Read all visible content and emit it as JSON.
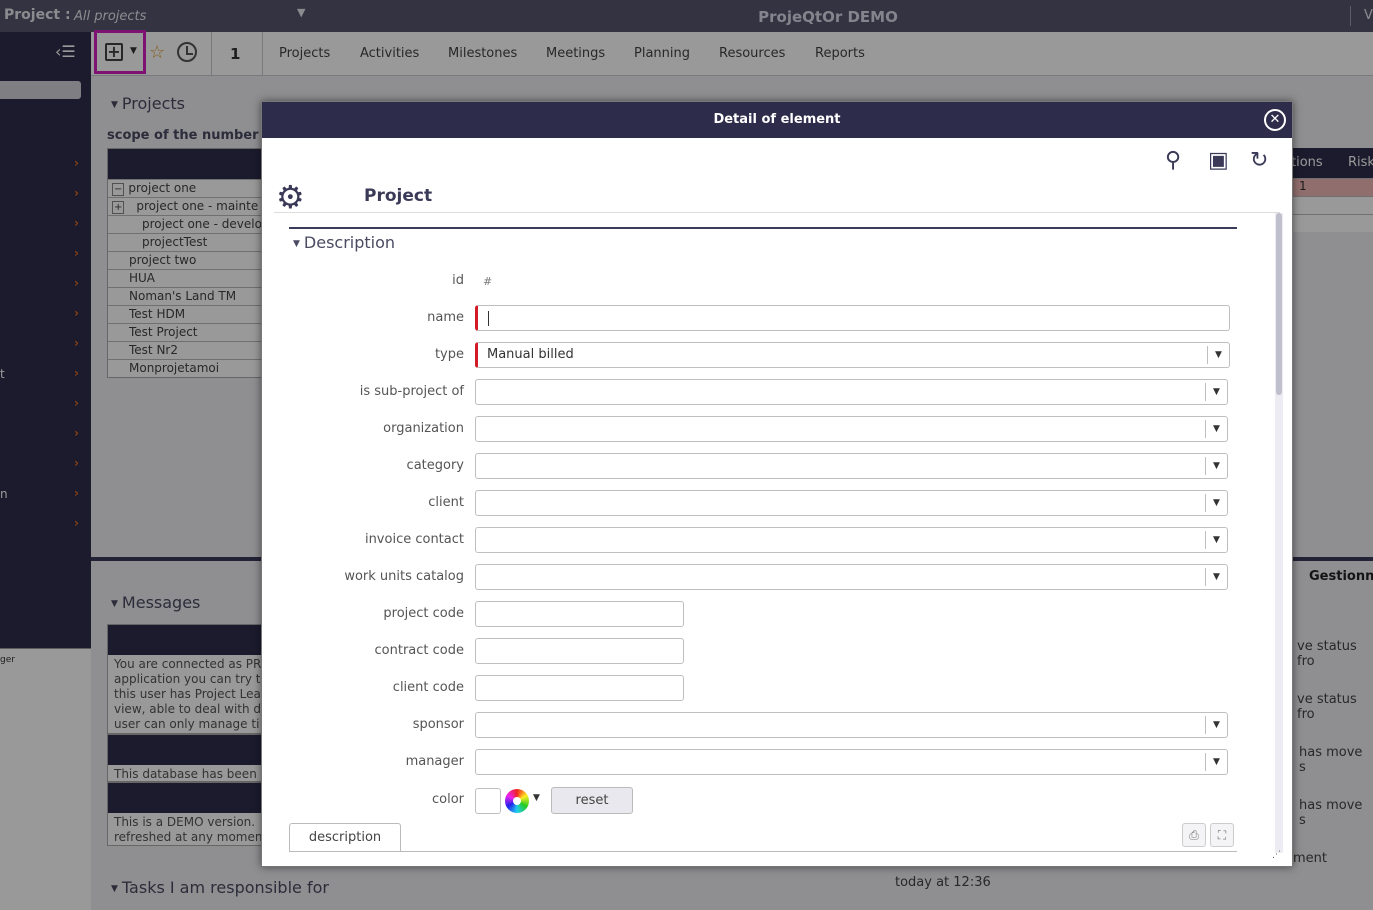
{
  "topbar": {
    "project_label": "Project :",
    "project_value": "All projects",
    "app_title": "ProjeQtOr DEMO",
    "right_char": "V"
  },
  "toolbar": {
    "count": "1",
    "menu": [
      "Projects",
      "Activities",
      "Milestones",
      "Meetings",
      "Planning",
      "Resources",
      "Reports"
    ]
  },
  "sidebar": {
    "labels": [
      "t",
      "n"
    ],
    "panel_text": "ger"
  },
  "projects_section": {
    "title": "Projects",
    "scope_label": "scope of the number",
    "rows": [
      "project one",
      "project one - mainte",
      "project one - develo",
      "projectTest",
      "project two",
      "HUA",
      "Noman's Land TM",
      "Test HDM",
      "Test Project",
      "Test Nr2",
      "Monprojetamoi"
    ]
  },
  "right_table": {
    "col_actions": "tions",
    "col_risks": "Risk",
    "first_value": "1"
  },
  "messages_section": {
    "title": "Messages",
    "msg1": [
      "You are connected as PR",
      "application you can try t",
      "this user has Project Lea",
      "view, able to deal with d",
      "user can only manage ti"
    ],
    "msg2": "This database has been",
    "msg3": [
      "This is a DEMO version.",
      "refreshed at any momen"
    ]
  },
  "tasks_section": {
    "title": "Tasks I am responsible for"
  },
  "activity_feed": {
    "user": "Gestionn",
    "lines": [
      "ve status fro",
      "ve status fro",
      "has move s",
      "has move s",
      "ment"
    ],
    "time": "today at 12:36"
  },
  "dialog": {
    "title": "Detail of element",
    "header": "Project",
    "section": "Description",
    "fields": {
      "id": {
        "label": "id",
        "value": "#"
      },
      "name": {
        "label": "name",
        "value": ""
      },
      "type": {
        "label": "type",
        "value": "Manual billed"
      },
      "subproject": {
        "label": "is sub-project of",
        "value": ""
      },
      "organization": {
        "label": "organization",
        "value": ""
      },
      "category": {
        "label": "category",
        "value": ""
      },
      "client": {
        "label": "client",
        "value": ""
      },
      "invoice_contact": {
        "label": "invoice contact",
        "value": ""
      },
      "work_units": {
        "label": "work units catalog",
        "value": ""
      },
      "project_code": {
        "label": "project code",
        "value": ""
      },
      "contract_code": {
        "label": "contract code",
        "value": ""
      },
      "client_code": {
        "label": "client code",
        "value": ""
      },
      "sponsor": {
        "label": "sponsor",
        "value": ""
      },
      "manager": {
        "label": "manager",
        "value": ""
      },
      "color": {
        "label": "color",
        "reset": "reset"
      }
    },
    "desc_tab": "description"
  },
  "colors": {
    "dark": "#2d2d4b",
    "topbar": "#56566f",
    "accent_orange": "#e86a1f",
    "required": "#d21b26",
    "highlight": "#d21fc0"
  }
}
